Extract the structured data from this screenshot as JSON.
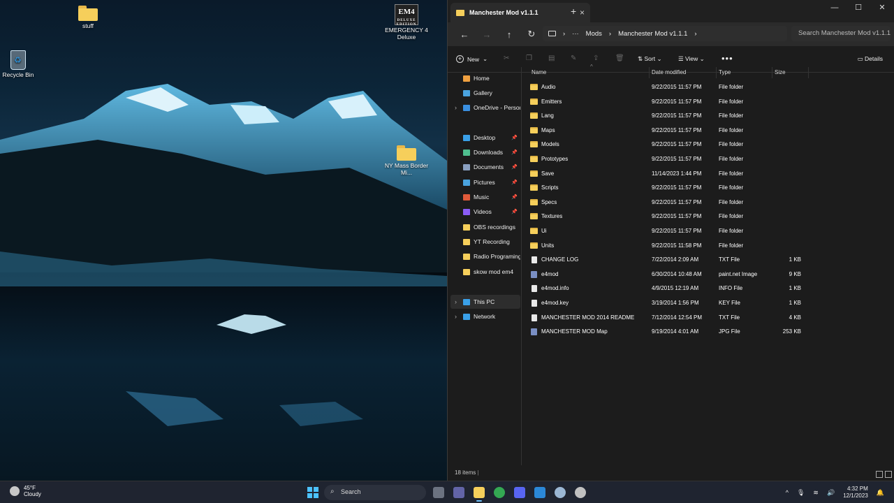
{
  "desktop": {
    "icons": [
      {
        "label": "stuff"
      },
      {
        "label": "Recycle Bin"
      },
      {
        "label": "EMERGENCY 4 Deluxe",
        "logo_text": "EM4",
        "logo_sub": "DELUXE EDITION"
      },
      {
        "label": "NY Mass Border Mi..."
      }
    ]
  },
  "explorer": {
    "tab_title": "Manchester Mod v1.1.1",
    "window_controls": {
      "minimize": "—",
      "maximize": "☐",
      "close": "✕"
    },
    "breadcrumb": [
      "Mods",
      "Manchester Mod v1.1.1"
    ],
    "search_placeholder": "Search Manchester Mod v1.1.1",
    "commands": {
      "new": "New",
      "sort": "Sort",
      "view": "View",
      "more": "•••",
      "details": "Details"
    },
    "nav": [
      {
        "label": "Home",
        "icon": "home-icon",
        "color": "#f0a040"
      },
      {
        "label": "Gallery",
        "icon": "gallery-icon",
        "color": "#4aa3df"
      },
      {
        "label": "OneDrive - Persona",
        "icon": "cloud-icon",
        "color": "#3a8fe0"
      },
      {
        "label": "Desktop",
        "icon": "desktop-icon",
        "color": "#3aa0e8"
      },
      {
        "label": "Downloads",
        "icon": "download-icon",
        "color": "#4fbf8f"
      },
      {
        "label": "Documents",
        "icon": "document-icon",
        "color": "#8aa0c0"
      },
      {
        "label": "Pictures",
        "icon": "pictures-icon",
        "color": "#4aa3df"
      },
      {
        "label": "Music",
        "icon": "music-icon",
        "color": "#e05a3a"
      },
      {
        "label": "Videos",
        "icon": "video-icon",
        "color": "#8b5cf6"
      },
      {
        "label": "OBS recordings",
        "icon": "folder-icon",
        "color": "#f6cf5b"
      },
      {
        "label": "YT Recording",
        "icon": "folder-icon",
        "color": "#f6cf5b"
      },
      {
        "label": "Radio Programing",
        "icon": "folder-icon",
        "color": "#f6cf5b"
      },
      {
        "label": "skow mod em4",
        "icon": "folder-icon",
        "color": "#f6cf5b"
      },
      {
        "label": "This PC",
        "icon": "pc-icon",
        "color": "#3aa0e8"
      },
      {
        "label": "Network",
        "icon": "network-icon",
        "color": "#3aa0e8"
      }
    ],
    "columns": {
      "name": "Name",
      "date": "Date modified",
      "type": "Type",
      "size": "Size"
    },
    "files": [
      {
        "name": "Audio",
        "date": "9/22/2015 11:57 PM",
        "type": "File folder",
        "size": "",
        "kind": "folder"
      },
      {
        "name": "Emitters",
        "date": "9/22/2015 11:57 PM",
        "type": "File folder",
        "size": "",
        "kind": "folder"
      },
      {
        "name": "Lang",
        "date": "9/22/2015 11:57 PM",
        "type": "File folder",
        "size": "",
        "kind": "folder"
      },
      {
        "name": "Maps",
        "date": "9/22/2015 11:57 PM",
        "type": "File folder",
        "size": "",
        "kind": "folder"
      },
      {
        "name": "Models",
        "date": "9/22/2015 11:57 PM",
        "type": "File folder",
        "size": "",
        "kind": "folder"
      },
      {
        "name": "Prototypes",
        "date": "9/22/2015 11:57 PM",
        "type": "File folder",
        "size": "",
        "kind": "folder"
      },
      {
        "name": "Save",
        "date": "11/14/2023 1:44 PM",
        "type": "File folder",
        "size": "",
        "kind": "folder"
      },
      {
        "name": "Scripts",
        "date": "9/22/2015 11:57 PM",
        "type": "File folder",
        "size": "",
        "kind": "folder"
      },
      {
        "name": "Specs",
        "date": "9/22/2015 11:57 PM",
        "type": "File folder",
        "size": "",
        "kind": "folder"
      },
      {
        "name": "Textures",
        "date": "9/22/2015 11:57 PM",
        "type": "File folder",
        "size": "",
        "kind": "folder"
      },
      {
        "name": "Ui",
        "date": "9/22/2015 11:57 PM",
        "type": "File folder",
        "size": "",
        "kind": "folder"
      },
      {
        "name": "Units",
        "date": "9/22/2015 11:58 PM",
        "type": "File folder",
        "size": "",
        "kind": "folder"
      },
      {
        "name": "CHANGE LOG",
        "date": "7/22/2014 2:09 AM",
        "type": "TXT File",
        "size": "1 KB",
        "kind": "file"
      },
      {
        "name": "e4mod",
        "date": "6/30/2014 10:48 AM",
        "type": "paint.net Image",
        "size": "9 KB",
        "kind": "img"
      },
      {
        "name": "e4mod.info",
        "date": "4/9/2015 12:19 AM",
        "type": "INFO File",
        "size": "1 KB",
        "kind": "file"
      },
      {
        "name": "e4mod.key",
        "date": "3/19/2014 1:56 PM",
        "type": "KEY File",
        "size": "1 KB",
        "kind": "file"
      },
      {
        "name": "MANCHESTER MOD 2014 README",
        "date": "7/12/2014 12:54 PM",
        "type": "TXT File",
        "size": "4 KB",
        "kind": "file"
      },
      {
        "name": "MANCHESTER MOD Map",
        "date": "9/19/2014 4:01 AM",
        "type": "JPG File",
        "size": "253 KB",
        "kind": "img"
      }
    ],
    "status": "18 items"
  },
  "taskbar": {
    "weather_temp": "45°F",
    "weather_desc": "Cloudy",
    "search_label": "Search",
    "apps": [
      {
        "name": "task-view-icon",
        "color": "#6b7280"
      },
      {
        "name": "teams-icon",
        "color": "#6264a7"
      },
      {
        "name": "file-explorer-icon",
        "color": "#f6cf5b"
      },
      {
        "name": "chrome-icon",
        "color": "#34a853"
      },
      {
        "name": "discord-icon",
        "color": "#5865f2"
      },
      {
        "name": "calendar-icon",
        "color": "#2b88d8"
      },
      {
        "name": "steam-icon",
        "color": "#9bb7d4"
      },
      {
        "name": "obs-icon",
        "color": "#c0c0c0"
      }
    ],
    "time": "4:32 PM",
    "date": "12/1/2023"
  }
}
